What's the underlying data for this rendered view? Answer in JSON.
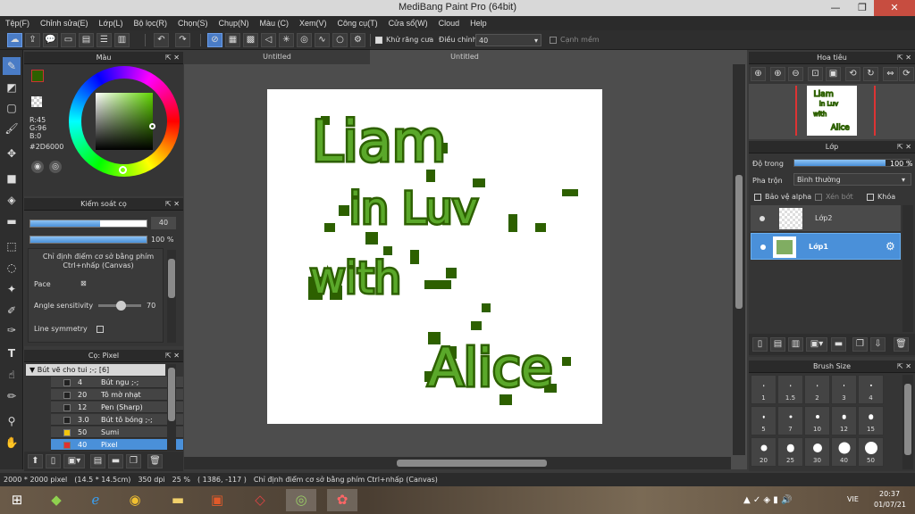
{
  "window": {
    "title": "MediBang Paint Pro (64bit)",
    "minimize": "—",
    "restore": "❐",
    "close": "✕"
  },
  "menu": [
    "Tệp(F)",
    "Chỉnh sửa(E)",
    "Lớp(L)",
    "Bộ lọc(R)",
    "Chọn(S)",
    "Chụp(N)",
    "Màu (C)",
    "Xem(V)",
    "Công cụ(T)",
    "Cửa sổ(W)",
    "Cloud",
    "Help"
  ],
  "toolbar": {
    "antialias_label": "Khử răng cưa",
    "adjust_label": "Điều chỉnh",
    "adjust_value": "40",
    "edge_label": "Cạnh mềm"
  },
  "color_panel": {
    "title": "Màu",
    "r": "R:45",
    "g": "G:96",
    "b": "B:0",
    "hex": "#2D6000",
    "primary_color": "#2D6000"
  },
  "brush_control": {
    "title": "Kiểm soát cọ",
    "size_value": "40",
    "opacity_value": "100 %",
    "size_fraction": 0.6,
    "opacity_fraction": 1.0,
    "hint": "Chỉ định điểm cơ sở bằng phím Ctrl+nhấp (Canvas)",
    "pace_label": "Pace",
    "angle_label": "Angle sensitivity",
    "angle_value": "70",
    "angle_fraction": 0.7,
    "line_symmetry_label": "Line symmetry"
  },
  "brush_list": {
    "title": "Cọ: Pixel",
    "group": "Bút vẽ cho tui ;-; [6]",
    "items": [
      {
        "num": "4",
        "name": "Bút ngu ;-;",
        "color": "#222222"
      },
      {
        "num": "20",
        "name": "Tô mờ nhạt",
        "color": "#222222"
      },
      {
        "num": "12",
        "name": "Pen (Sharp)",
        "color": "#222222"
      },
      {
        "num": "3.0",
        "name": "Bút tô bóng ;-;",
        "color": "#222222"
      },
      {
        "num": "50",
        "name": "Sumi",
        "color": "#f2c40c"
      },
      {
        "num": "40",
        "name": "Pixel",
        "color": "#e03030"
      }
    ]
  },
  "documents": {
    "tab1": "Untitled",
    "tab2": "Untitled"
  },
  "navigator": {
    "title": "Hoa tiêu"
  },
  "layers": {
    "title": "Lớp",
    "opacity_label": "Độ trong",
    "opacity_value": "100 %",
    "opacity_fraction": 1.0,
    "blend_label": "Pha trộn",
    "blend_value": "Bình thường",
    "protect_alpha": "Bảo vệ alpha",
    "clipping": "Xén bớt",
    "lock": "Khóa",
    "items": [
      {
        "name": "Lớp2"
      },
      {
        "name": "Lớp1"
      }
    ]
  },
  "brush_size": {
    "title": "Brush Size",
    "sizes": [
      "1",
      "1.5",
      "2",
      "3",
      "4",
      "5",
      "7",
      "10",
      "12",
      "15",
      "20",
      "25",
      "30",
      "40",
      "50"
    ]
  },
  "status": {
    "size": "2000 * 2000 pixel",
    "cm": "(14.5 * 14.5cm)",
    "dpi": "350 dpi",
    "zoom": "25 %",
    "coords": "( 1386, -117 )",
    "hint": "Chỉ định điểm cơ sở bằng phím Ctrl+nhấp (Canvas)"
  },
  "taskbar": {
    "lang": "VIE",
    "time": "20:37",
    "date": "01/07/21"
  },
  "artwork": {
    "line1": "Liam",
    "line2": "in Luv",
    "line3": "with",
    "line4": "Alice",
    "dark_color": "#2D6000",
    "light_color": "#5aa82a"
  }
}
